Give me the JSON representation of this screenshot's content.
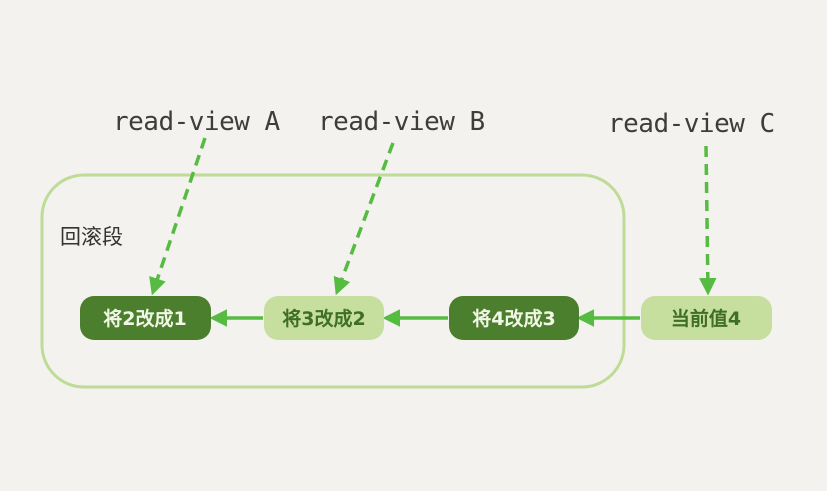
{
  "read_views": [
    {
      "label": "read-view A"
    },
    {
      "label": "read-view B"
    },
    {
      "label": "read-view C"
    }
  ],
  "undo_segment": {
    "label": "回滚段"
  },
  "nodes": [
    {
      "label": "将2改成1",
      "style": "dark"
    },
    {
      "label": "将3改成2",
      "style": "light"
    },
    {
      "label": "将4改成3",
      "style": "dark"
    },
    {
      "label": "当前值4",
      "style": "light"
    }
  ],
  "colors": {
    "background": "#f3f2ee",
    "dark_node": "#4c7f2d",
    "light_node": "#c7df9e",
    "arrow": "#56bb41",
    "segment_border": "#bfdb98"
  }
}
